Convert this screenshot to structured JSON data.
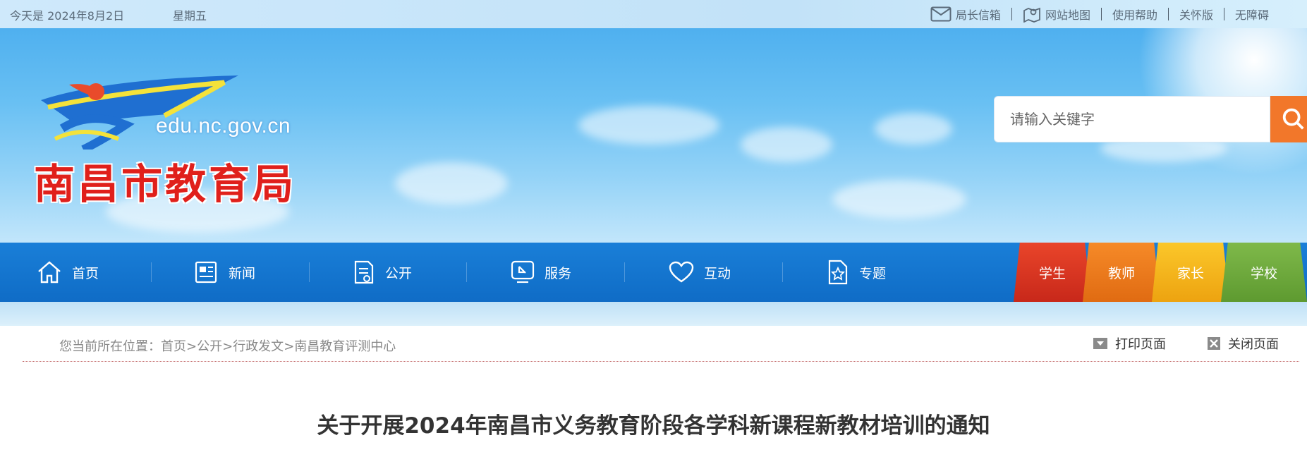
{
  "topbar": {
    "date": "今天是 2024年8月2日",
    "weekday": "星期五",
    "links": [
      {
        "label": "局长信箱",
        "icon": "mail-icon"
      },
      {
        "label": "网站地图",
        "icon": "map-icon"
      },
      {
        "label": "使用帮助"
      },
      {
        "label": "关怀版"
      },
      {
        "label": "无障碍"
      }
    ]
  },
  "logo": {
    "domain": "edu.nc.gov.cn",
    "org": "南昌市教育局"
  },
  "search": {
    "placeholder": "请输入关键字",
    "button_icon": "search-icon"
  },
  "nav": {
    "items": [
      {
        "label": "首页",
        "icon": "home-icon"
      },
      {
        "label": "新闻",
        "icon": "news-icon"
      },
      {
        "label": "公开",
        "icon": "document-icon"
      },
      {
        "label": "服务",
        "icon": "service-icon"
      },
      {
        "label": "互动",
        "icon": "heart-icon"
      },
      {
        "label": "专题",
        "icon": "star-document-icon"
      }
    ],
    "audience_tabs": [
      {
        "label": "学生",
        "color": "#d6331e"
      },
      {
        "label": "教师",
        "color": "#ef7a1a"
      },
      {
        "label": "家长",
        "color": "#f3b316"
      },
      {
        "label": "学校",
        "color": "#6aa53a"
      }
    ]
  },
  "breadcrumb": {
    "prefix": "您当前所在位置：",
    "parts": [
      "首页",
      "公开",
      "行政发文",
      "南昌教育评测中心"
    ],
    "separator": ">"
  },
  "tools": {
    "print": "打印页面",
    "close": "关闭页面"
  },
  "article": {
    "title": "关于开展2024年南昌市义务教育阶段各学科新课程新教材培训的通知"
  }
}
